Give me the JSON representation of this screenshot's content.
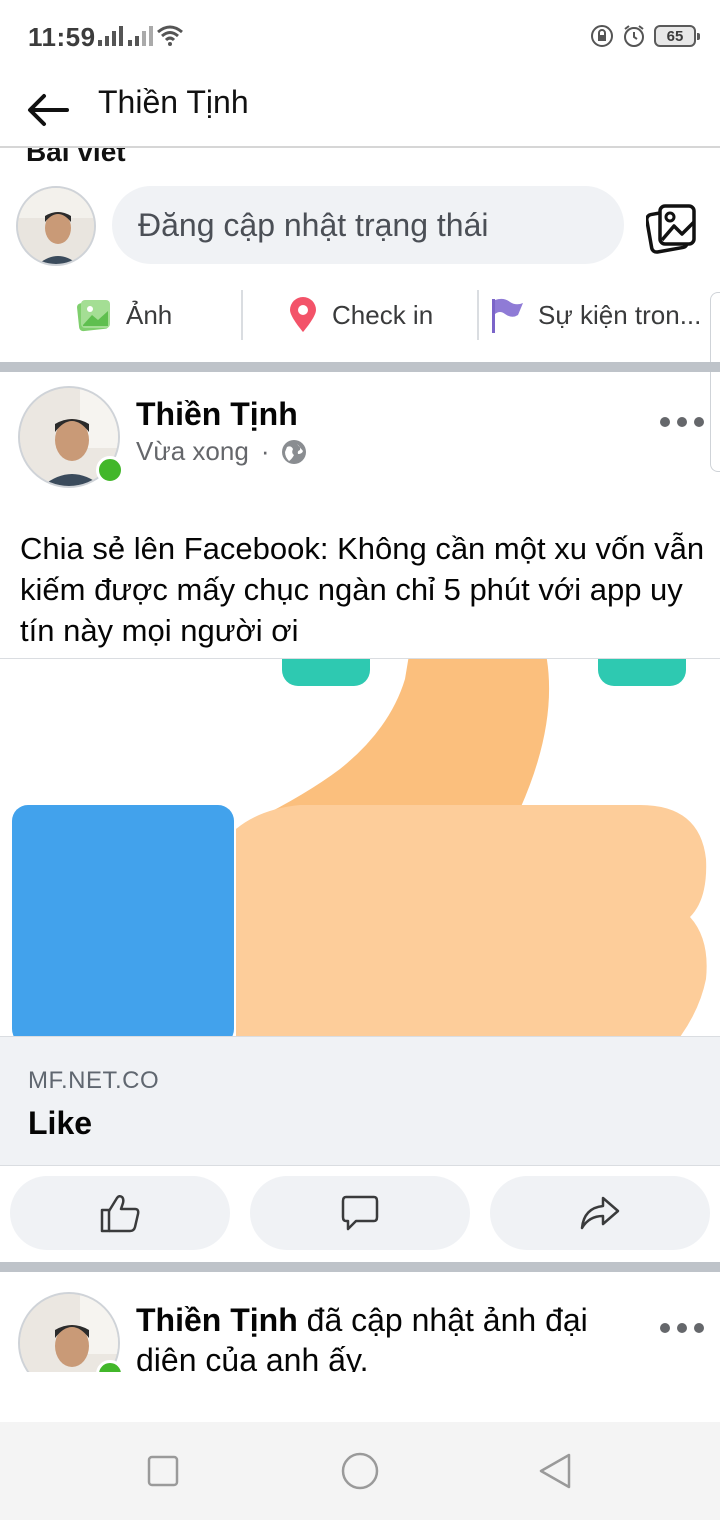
{
  "status_bar": {
    "time": "11:59",
    "battery": "65"
  },
  "header": {
    "title": "Thiền Tịnh"
  },
  "section_peek": "Bài viết",
  "composer": {
    "placeholder": "Đăng cập nhật trạng thái",
    "actions": [
      {
        "label": "Ảnh",
        "icon": "photo-icon"
      },
      {
        "label": "Check in",
        "icon": "location-pin-icon"
      },
      {
        "label": "Sự kiện tron...",
        "icon": "flag-icon"
      }
    ]
  },
  "post": {
    "author": "Thiền Tịnh",
    "time": "Vừa xong",
    "separator": "·",
    "privacy_icon": "globe-icon",
    "text": "Chia sẻ lên Facebook: Không cần một xu vốn vẫn kiếm được mấy chục ngàn chỉ 5 phút với app uy tín này mọi người ơi",
    "link": {
      "domain": "MF.NET.CO",
      "title": "Like"
    },
    "reactions": [
      "like-icon",
      "comment-icon",
      "share-icon"
    ]
  },
  "post2": {
    "author": "Thiền Tịnh",
    "text": " đã cập nhật ảnh đại diện của anh ấy."
  },
  "colors": {
    "accent": "#1877f2",
    "online": "#42b72a",
    "thumb_sleeve": "#42a2ec",
    "thumb_skin": "#fdcd9a",
    "thumb_shadow": "#fbbf7d",
    "sparkle": "#2ec9b1"
  }
}
